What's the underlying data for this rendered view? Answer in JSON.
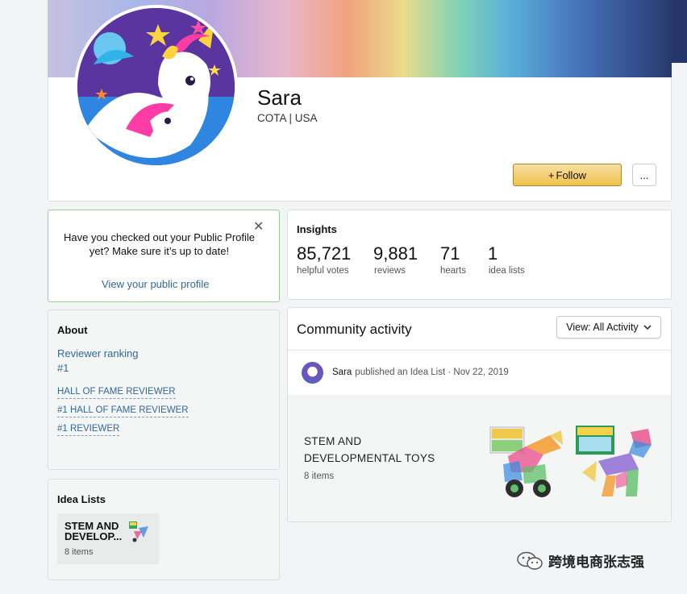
{
  "profile": {
    "name": "Sara",
    "location": "COTA | USA",
    "follow_label": "Follow",
    "follow_icon": "plus-icon",
    "more_label": "..."
  },
  "public_profile_prompt": {
    "text": "Have you checked out your Public Profile yet? Make sure it’s up to date!",
    "link": "View your public profile",
    "close_icon": "close-icon"
  },
  "insights": {
    "title": "Insights",
    "stats": [
      {
        "value": "85,721",
        "label": "helpful votes"
      },
      {
        "value": "9,881",
        "label": "reviews"
      },
      {
        "value": "71",
        "label": "hearts"
      },
      {
        "value": "1",
        "label": "idea lists"
      }
    ]
  },
  "about": {
    "title": "About",
    "ranking_label": "Reviewer ranking",
    "ranking_value": "#1",
    "badges": [
      "HALL OF FAME REVIEWER",
      "#1 HALL OF FAME REVIEWER",
      "#1 REVIEWER"
    ]
  },
  "idea_lists": {
    "title": "Idea Lists",
    "items": [
      {
        "name": "STEM AND DEVELOP...",
        "count": "8 items"
      }
    ]
  },
  "community": {
    "title": "Community activity",
    "view_label": "View: All Activity",
    "activity": {
      "user": "Sara",
      "action": "published an Idea List · Nov 22, 2019",
      "item_title_line1": "STEM AND",
      "item_title_line2": "DEVELOPMENTAL TOYS",
      "item_count": "8 items"
    }
  },
  "watermark": {
    "text": "跨境电商张志强"
  },
  "colors": {
    "follow_button": "#f0c14b",
    "link": "#31689b",
    "accent_border": "#9ccf97"
  }
}
